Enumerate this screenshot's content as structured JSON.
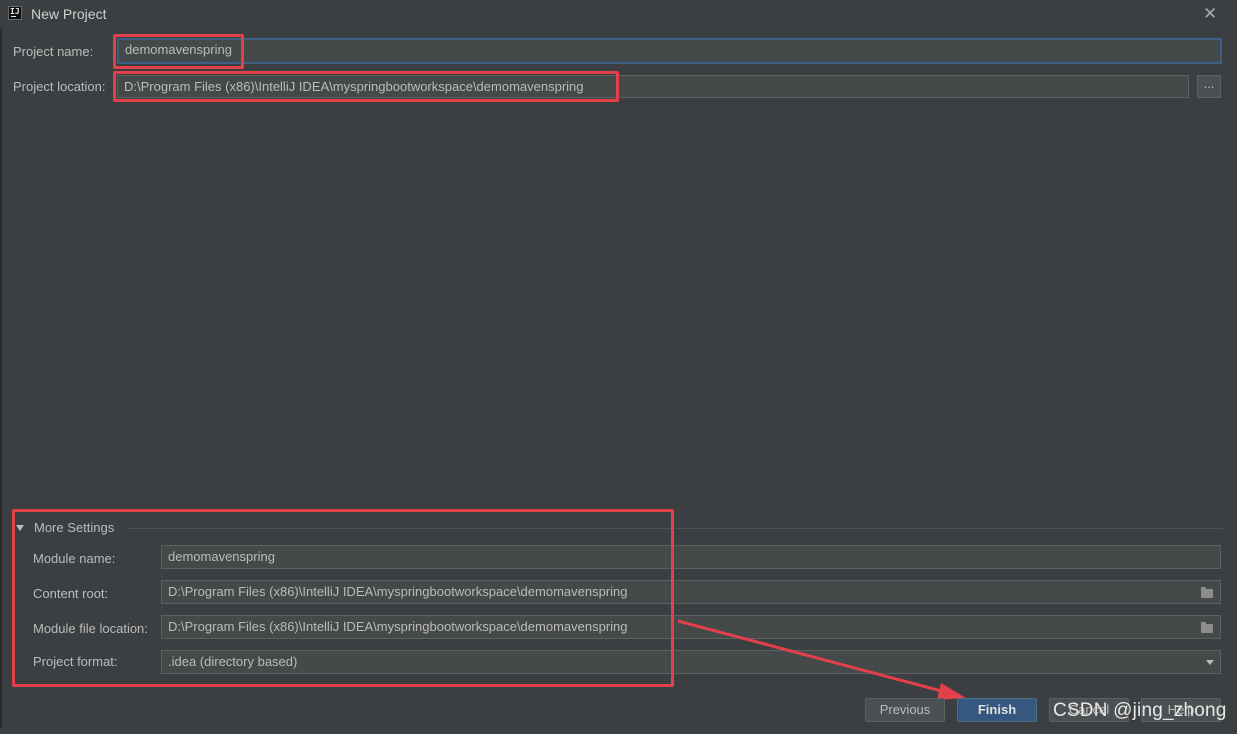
{
  "window": {
    "title": "New Project",
    "app_icon_text": "IJ"
  },
  "project": {
    "name_label": "Project name:",
    "name_value": "demomavenspring",
    "location_label": "Project location:",
    "location_value": "D:\\Program Files (x86)\\IntelliJ IDEA\\myspringbootworkspace\\demomavenspring",
    "browse_label": "..."
  },
  "more_settings": {
    "header": "More Settings",
    "expanded": true,
    "module_name_label": "Module name:",
    "module_name_value": "demomavenspring",
    "content_root_label": "Content root:",
    "content_root_value": "D:\\Program Files (x86)\\IntelliJ IDEA\\myspringbootworkspace\\demomavenspring",
    "module_file_location_label": "Module file location:",
    "module_file_location_value": "D:\\Program Files (x86)\\IntelliJ IDEA\\myspringbootworkspace\\demomavenspring",
    "project_format_label": "Project format:",
    "project_format_value": ".idea (directory based)"
  },
  "buttons": {
    "previous": "Previous",
    "finish": "Finish",
    "cancel": "Cancel",
    "help": "Help"
  },
  "overlay": {
    "watermark": "CSDN @jing_zhong"
  },
  "colors": {
    "background": "#3c3f41",
    "field_bg": "#45494a",
    "focus_border": "#3d6185",
    "primary_button": "#365880",
    "annotation_red": "#e2404a"
  }
}
